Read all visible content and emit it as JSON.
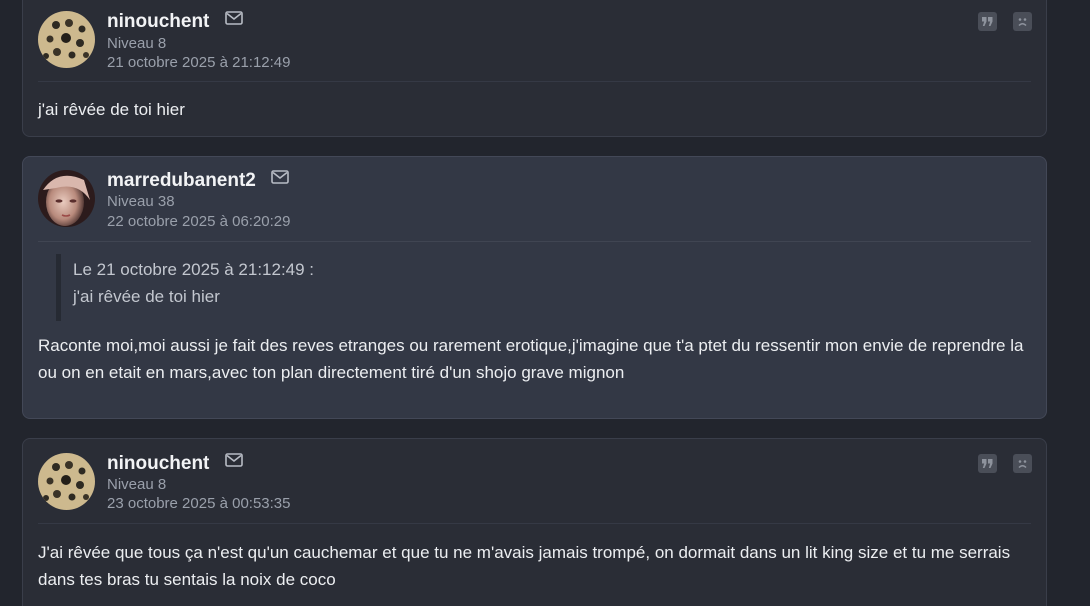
{
  "posts": [
    {
      "author": "ninouchent",
      "level": "Niveau 8",
      "date": "21 octobre 2025 à 21:12:49",
      "body": "j'ai rêvée de toi hier"
    },
    {
      "author": "marredubanent2",
      "level": "Niveau 38",
      "date": "22 octobre 2025 à 06:20:29",
      "quote_header": "Le 21 octobre 2025 à 21:12:49 :",
      "quote_text": "j'ai rêvée de toi hier",
      "body": "Raconte moi,moi aussi je fait des reves etranges ou rarement erotique,j'imagine que t'a ptet du ressentir mon envie de reprendre la ou on en etait en mars,avec ton plan directement tiré d'un shojo grave mignon"
    },
    {
      "author": "ninouchent",
      "level": "Niveau 8",
      "date": "23 octobre 2025 à 00:53:35",
      "body": "J'ai rêvée que tous ça n'est qu'un cauchemar et que tu ne m'avais jamais trompé, on dormait dans un lit king size et tu me serrais dans tes bras tu sentais la noix de coco"
    }
  ],
  "icons": {
    "mail": "mail-icon",
    "quote": "quote-icon",
    "report": "sad-face-icon"
  },
  "colors": {
    "background": "#22252d",
    "post": "#2a2d36",
    "post_highlighted": "#333845",
    "muted_text": "#9aa0ab"
  }
}
